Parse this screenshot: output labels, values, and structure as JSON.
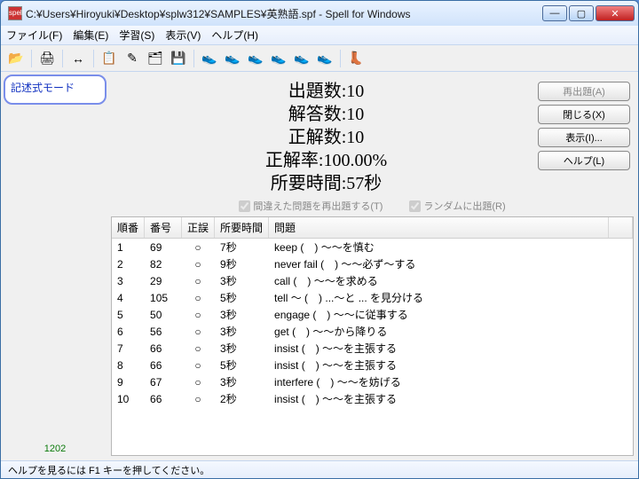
{
  "window": {
    "title": "C:¥Users¥Hiroyuki¥Desktop¥splw312¥SAMPLES¥英熟語.spf - Spell for Windows",
    "icon_label": "spell"
  },
  "menu": {
    "file": "ファイル(F)",
    "edit": "編集(E)",
    "study": "学習(S)",
    "view": "表示(V)",
    "help": "ヘルプ(H)"
  },
  "toolbar_icons": {
    "open": "📂",
    "print": "🖨",
    "hsize": "↔",
    "exam": "📋",
    "edit": "✎",
    "cards": "🗂",
    "save": "💾",
    "r1": "👟",
    "r2": "👟",
    "r3": "👟",
    "r4": "👟",
    "r5": "👟",
    "r6": "👟",
    "boot": "👢"
  },
  "side": {
    "mode": "記述式モード",
    "bottom": "1202"
  },
  "summary": {
    "line1_label": "出題数:",
    "line1_value": "10",
    "line2_label": "解答数:",
    "line2_value": "10",
    "line3_label": "正解数:",
    "line3_value": "10",
    "line4_label": "正解率:",
    "line4_value": "100.00%",
    "line5_label": "所要時間:",
    "line5_value": "57秒"
  },
  "action_buttons": {
    "reissue": "再出題(A)",
    "close": "閉じる(X)",
    "display": "表示(I)...",
    "help": "ヘルプ(L)"
  },
  "checks": {
    "reissue_wrong": "間違えた問題を再出題する(T)",
    "random": "ランダムに出題(R)"
  },
  "table": {
    "headers": {
      "seq": "順番",
      "num": "番号",
      "ok": "正誤",
      "time": "所要時間",
      "q": "問題"
    },
    "ok_mark": "○",
    "rows": [
      {
        "seq": "1",
        "num": "69",
        "time": "7秒",
        "q": "keep (　) ～～を慎む"
      },
      {
        "seq": "2",
        "num": "82",
        "time": "9秒",
        "q": "never fail (　) ～～必ず～する"
      },
      {
        "seq": "3",
        "num": "29",
        "time": "3秒",
        "q": "call (　) ～～を求める"
      },
      {
        "seq": "4",
        "num": "105",
        "time": "5秒",
        "q": "tell ～ (　) ...～と ... を見分ける"
      },
      {
        "seq": "5",
        "num": "50",
        "time": "3秒",
        "q": "engage (　) ～～に従事する"
      },
      {
        "seq": "6",
        "num": "56",
        "time": "3秒",
        "q": "get (　) ～～から降りる"
      },
      {
        "seq": "7",
        "num": "66",
        "time": "3秒",
        "q": "insist (　) ～～を主張する"
      },
      {
        "seq": "8",
        "num": "66",
        "time": "5秒",
        "q": "insist (　) ～～を主張する"
      },
      {
        "seq": "9",
        "num": "67",
        "time": "3秒",
        "q": "interfere (　) ～～を妨げる"
      },
      {
        "seq": "10",
        "num": "66",
        "time": "2秒",
        "q": "insist (　) ～～を主張する"
      }
    ]
  },
  "status": "ヘルプを見るには F1 キーを押してください。"
}
